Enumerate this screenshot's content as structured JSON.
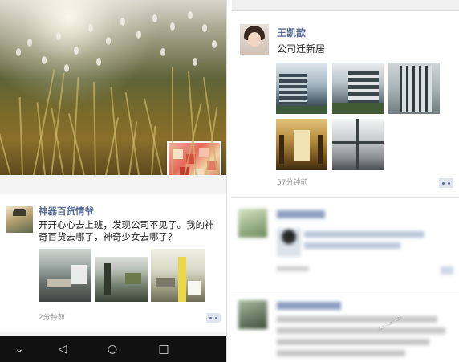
{
  "left_panel": {
    "post": {
      "author": "神器百货情爷",
      "text": "开开心心去上班，发现公司不见了。我的神奇百货去哪了，神奇少女去哪了？",
      "photos": [
        "office-photo-1",
        "office-photo-2",
        "office-photo-3"
      ],
      "time": "2分钟前"
    },
    "navbar": {
      "back_icon": "chevron-down-icon",
      "back": "⌄",
      "home": "◁",
      "circle": "○",
      "square": "□"
    }
  },
  "right_panel": {
    "post": {
      "author": "王凯歆",
      "text": "公司迁新居",
      "photos": [
        "building-photo-1",
        "building-photo-2",
        "building-photo-3",
        "interior-photo-4",
        "window-photo-5"
      ],
      "time": "57分钟前"
    }
  },
  "colors": {
    "link": "#576b95",
    "time": "#999999",
    "text": "#222222"
  }
}
